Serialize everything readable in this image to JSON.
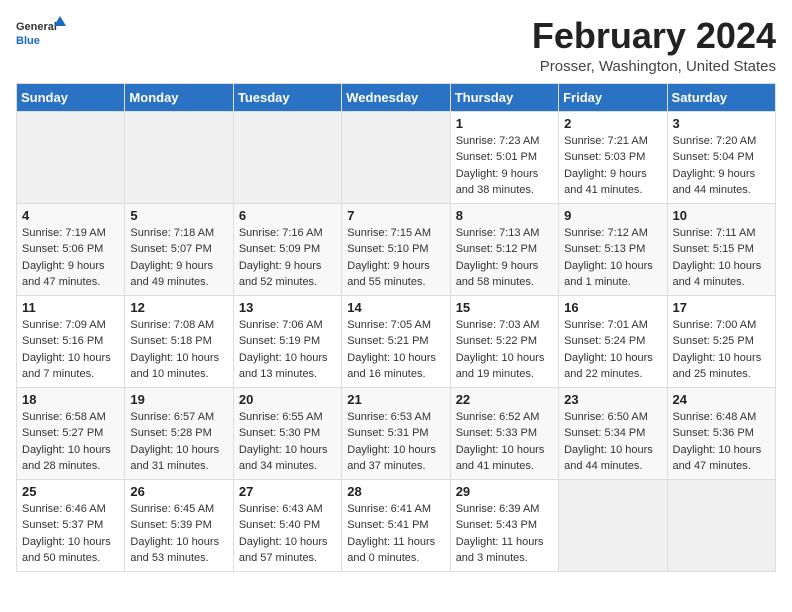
{
  "header": {
    "logo_general": "General",
    "logo_blue": "Blue",
    "month_title": "February 2024",
    "location": "Prosser, Washington, United States"
  },
  "days_of_week": [
    "Sunday",
    "Monday",
    "Tuesday",
    "Wednesday",
    "Thursday",
    "Friday",
    "Saturday"
  ],
  "weeks": [
    [
      {
        "day": "",
        "info": ""
      },
      {
        "day": "",
        "info": ""
      },
      {
        "day": "",
        "info": ""
      },
      {
        "day": "",
        "info": ""
      },
      {
        "day": "1",
        "info": "Sunrise: 7:23 AM\nSunset: 5:01 PM\nDaylight: 9 hours\nand 38 minutes."
      },
      {
        "day": "2",
        "info": "Sunrise: 7:21 AM\nSunset: 5:03 PM\nDaylight: 9 hours\nand 41 minutes."
      },
      {
        "day": "3",
        "info": "Sunrise: 7:20 AM\nSunset: 5:04 PM\nDaylight: 9 hours\nand 44 minutes."
      }
    ],
    [
      {
        "day": "4",
        "info": "Sunrise: 7:19 AM\nSunset: 5:06 PM\nDaylight: 9 hours\nand 47 minutes."
      },
      {
        "day": "5",
        "info": "Sunrise: 7:18 AM\nSunset: 5:07 PM\nDaylight: 9 hours\nand 49 minutes."
      },
      {
        "day": "6",
        "info": "Sunrise: 7:16 AM\nSunset: 5:09 PM\nDaylight: 9 hours\nand 52 minutes."
      },
      {
        "day": "7",
        "info": "Sunrise: 7:15 AM\nSunset: 5:10 PM\nDaylight: 9 hours\nand 55 minutes."
      },
      {
        "day": "8",
        "info": "Sunrise: 7:13 AM\nSunset: 5:12 PM\nDaylight: 9 hours\nand 58 minutes."
      },
      {
        "day": "9",
        "info": "Sunrise: 7:12 AM\nSunset: 5:13 PM\nDaylight: 10 hours\nand 1 minute."
      },
      {
        "day": "10",
        "info": "Sunrise: 7:11 AM\nSunset: 5:15 PM\nDaylight: 10 hours\nand 4 minutes."
      }
    ],
    [
      {
        "day": "11",
        "info": "Sunrise: 7:09 AM\nSunset: 5:16 PM\nDaylight: 10 hours\nand 7 minutes."
      },
      {
        "day": "12",
        "info": "Sunrise: 7:08 AM\nSunset: 5:18 PM\nDaylight: 10 hours\nand 10 minutes."
      },
      {
        "day": "13",
        "info": "Sunrise: 7:06 AM\nSunset: 5:19 PM\nDaylight: 10 hours\nand 13 minutes."
      },
      {
        "day": "14",
        "info": "Sunrise: 7:05 AM\nSunset: 5:21 PM\nDaylight: 10 hours\nand 16 minutes."
      },
      {
        "day": "15",
        "info": "Sunrise: 7:03 AM\nSunset: 5:22 PM\nDaylight: 10 hours\nand 19 minutes."
      },
      {
        "day": "16",
        "info": "Sunrise: 7:01 AM\nSunset: 5:24 PM\nDaylight: 10 hours\nand 22 minutes."
      },
      {
        "day": "17",
        "info": "Sunrise: 7:00 AM\nSunset: 5:25 PM\nDaylight: 10 hours\nand 25 minutes."
      }
    ],
    [
      {
        "day": "18",
        "info": "Sunrise: 6:58 AM\nSunset: 5:27 PM\nDaylight: 10 hours\nand 28 minutes."
      },
      {
        "day": "19",
        "info": "Sunrise: 6:57 AM\nSunset: 5:28 PM\nDaylight: 10 hours\nand 31 minutes."
      },
      {
        "day": "20",
        "info": "Sunrise: 6:55 AM\nSunset: 5:30 PM\nDaylight: 10 hours\nand 34 minutes."
      },
      {
        "day": "21",
        "info": "Sunrise: 6:53 AM\nSunset: 5:31 PM\nDaylight: 10 hours\nand 37 minutes."
      },
      {
        "day": "22",
        "info": "Sunrise: 6:52 AM\nSunset: 5:33 PM\nDaylight: 10 hours\nand 41 minutes."
      },
      {
        "day": "23",
        "info": "Sunrise: 6:50 AM\nSunset: 5:34 PM\nDaylight: 10 hours\nand 44 minutes."
      },
      {
        "day": "24",
        "info": "Sunrise: 6:48 AM\nSunset: 5:36 PM\nDaylight: 10 hours\nand 47 minutes."
      }
    ],
    [
      {
        "day": "25",
        "info": "Sunrise: 6:46 AM\nSunset: 5:37 PM\nDaylight: 10 hours\nand 50 minutes."
      },
      {
        "day": "26",
        "info": "Sunrise: 6:45 AM\nSunset: 5:39 PM\nDaylight: 10 hours\nand 53 minutes."
      },
      {
        "day": "27",
        "info": "Sunrise: 6:43 AM\nSunset: 5:40 PM\nDaylight: 10 hours\nand 57 minutes."
      },
      {
        "day": "28",
        "info": "Sunrise: 6:41 AM\nSunset: 5:41 PM\nDaylight: 11 hours\nand 0 minutes."
      },
      {
        "day": "29",
        "info": "Sunrise: 6:39 AM\nSunset: 5:43 PM\nDaylight: 11 hours\nand 3 minutes."
      },
      {
        "day": "",
        "info": ""
      },
      {
        "day": "",
        "info": ""
      }
    ]
  ]
}
